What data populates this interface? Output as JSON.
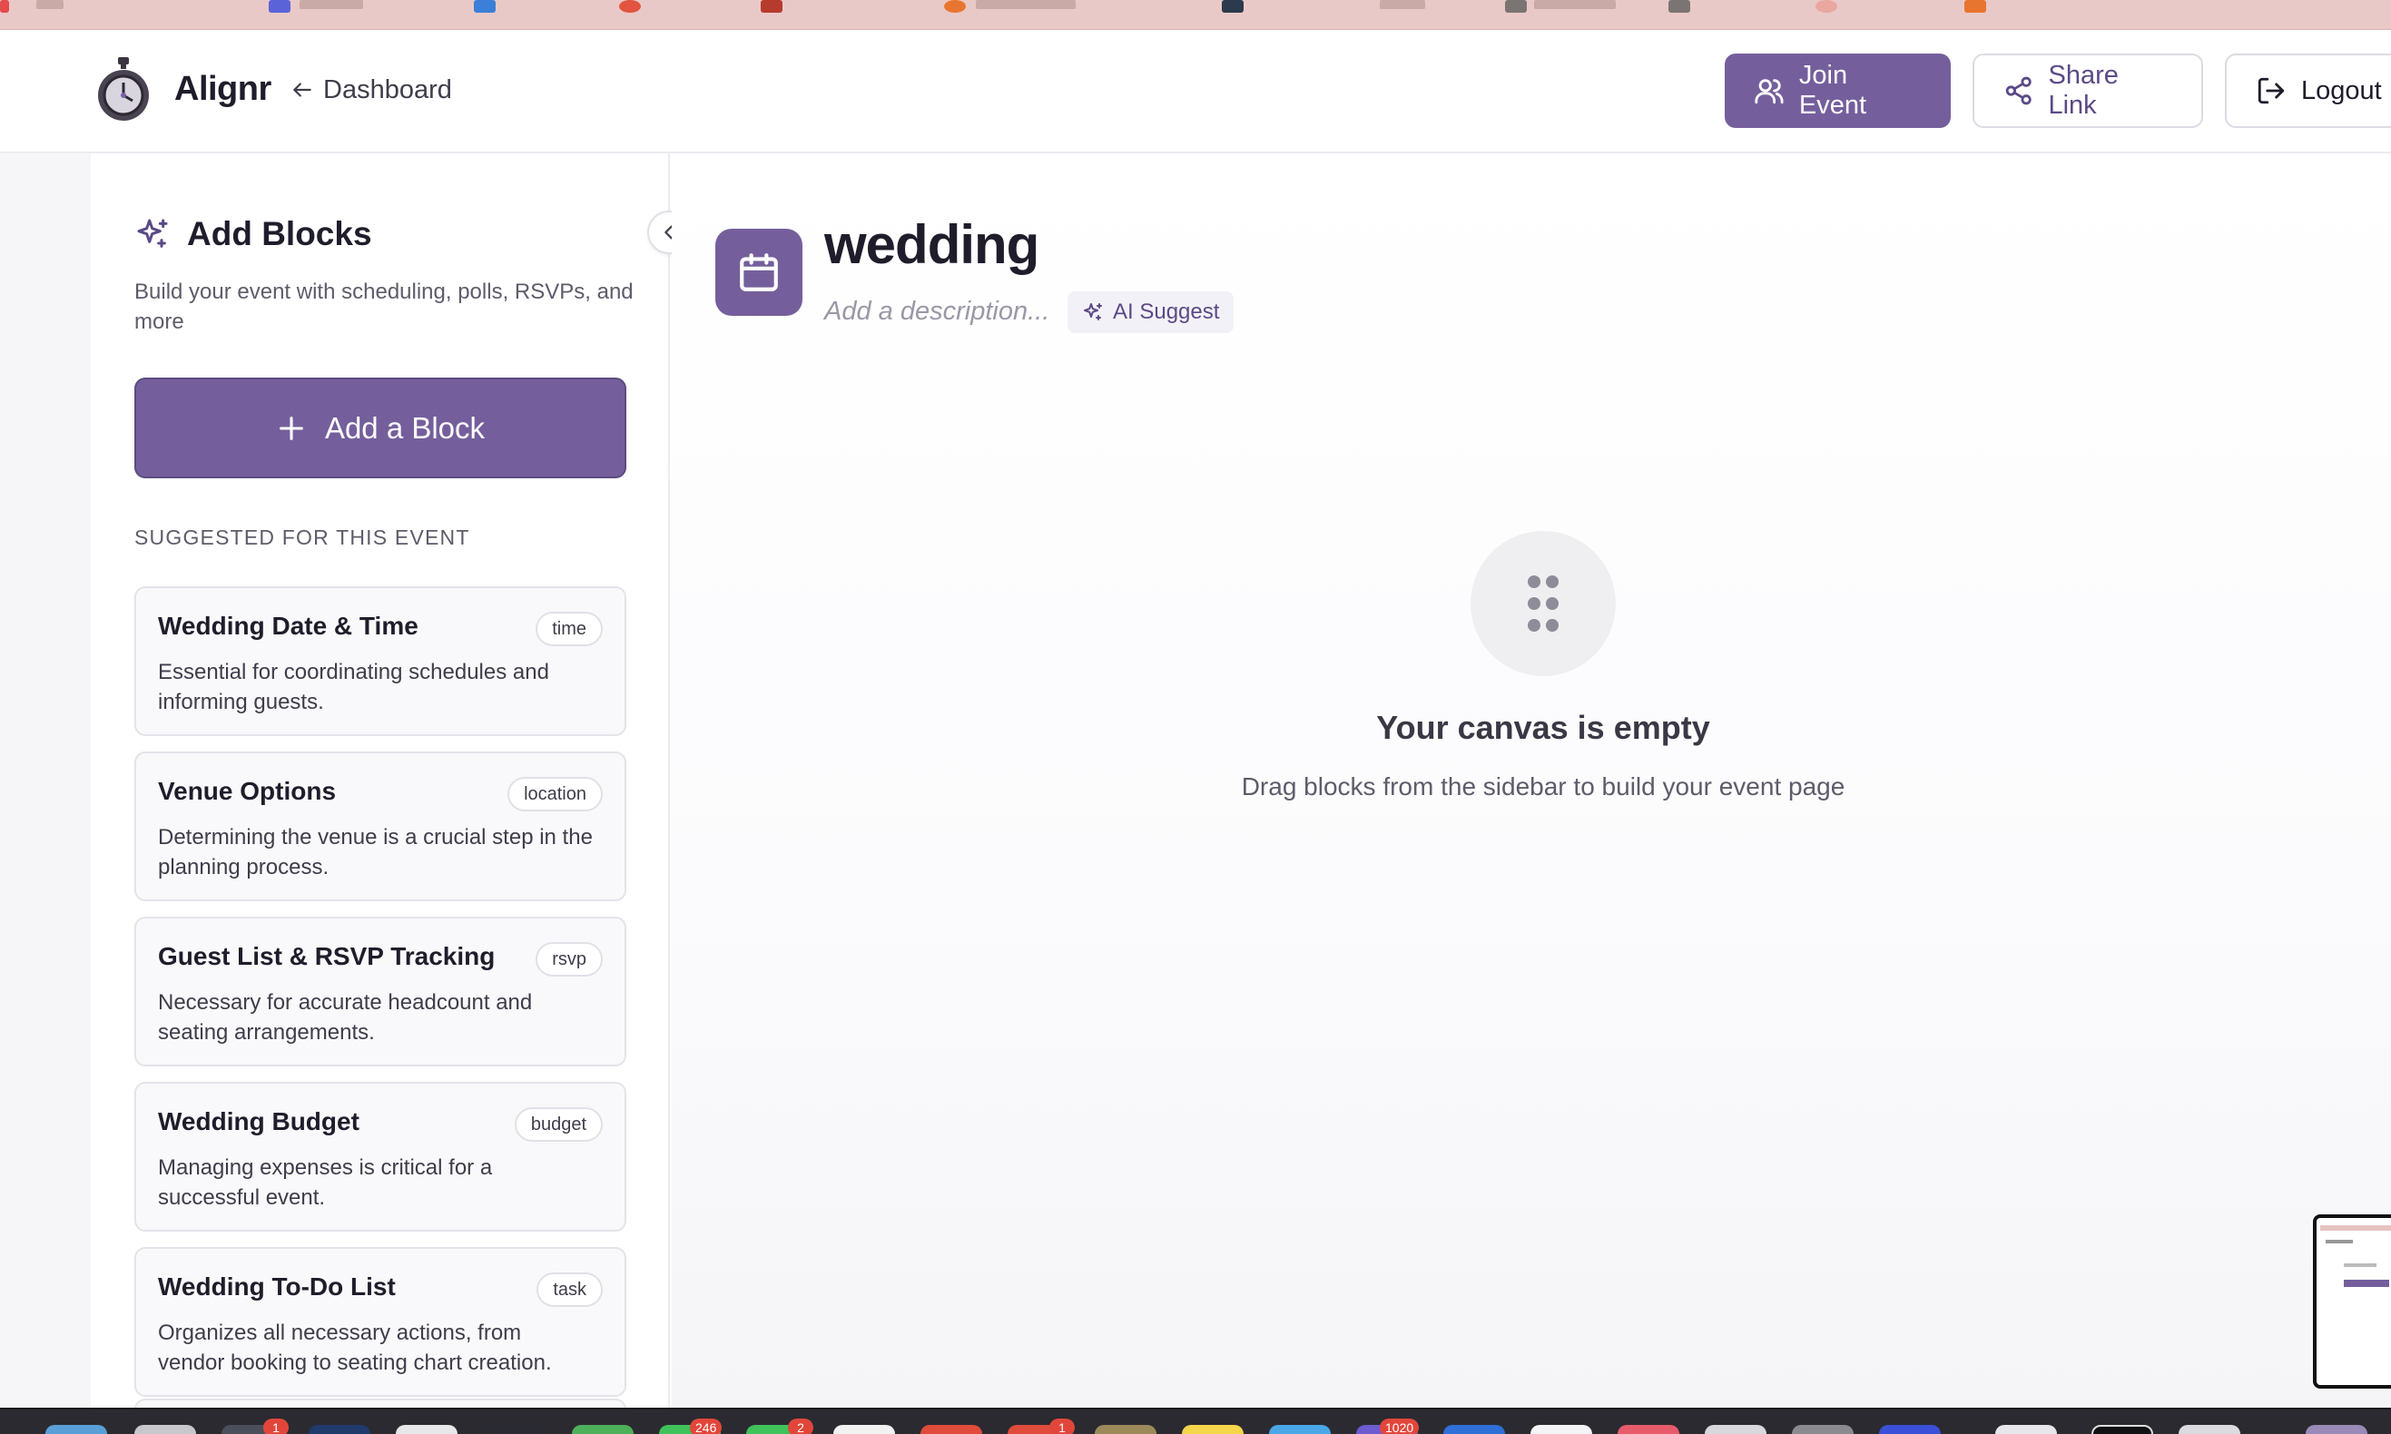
{
  "header": {
    "brand": "Alignr",
    "back_label": "Dashboard",
    "join_label": "Join Event",
    "share_label": "Share Link",
    "logout_label": "Logout"
  },
  "sidebar": {
    "title": "Add Blocks",
    "subtitle": "Build your event with scheduling, polls, RSVPs, and more",
    "add_button_label": "Add a Block",
    "suggested_heading": "SUGGESTED FOR THIS EVENT",
    "suggestions": [
      {
        "title": "Wedding Date & Time",
        "tag": "time",
        "description": "Essential for coordinating schedules and informing guests."
      },
      {
        "title": "Venue Options",
        "tag": "location",
        "description": "Determining the venue is a crucial step in the planning process."
      },
      {
        "title": "Guest List & RSVP Tracking",
        "tag": "rsvp",
        "description": "Necessary for accurate headcount and seating arrangements."
      },
      {
        "title": "Wedding Budget",
        "tag": "budget",
        "description": "Managing expenses is critical for a successful event."
      },
      {
        "title": "Wedding To-Do List",
        "tag": "task",
        "description": "Organizes all necessary actions, from vendor booking to seating chart creation."
      }
    ]
  },
  "event": {
    "title": "wedding",
    "description_placeholder": "Add a description...",
    "ai_suggest_label": "AI Suggest"
  },
  "canvas": {
    "empty_title": "Your canvas is empty",
    "empty_subtitle": "Drag blocks from the sidebar to build your event page"
  },
  "dock": {
    "badges": [
      "1",
      "246",
      "2",
      "1",
      "1020"
    ]
  },
  "colors": {
    "accent": "#745f9c",
    "accent_text": "#5b4a86",
    "border": "#e4e3ea",
    "tabstrip": "#e9c9c7",
    "dock": "#2b2a30",
    "badge": "#e2463b"
  },
  "icons": {
    "logo": "stopwatch-logo-icon",
    "back": "arrow-left-icon",
    "join": "users-icon",
    "share": "share-icon",
    "logout": "logout-icon",
    "sidebar_title": "sparkles-icon",
    "add": "plus-icon",
    "collapse": "chevron-left-icon",
    "event": "calendar-icon",
    "ai": "sparkles-icon",
    "empty": "grip-dots-icon"
  }
}
